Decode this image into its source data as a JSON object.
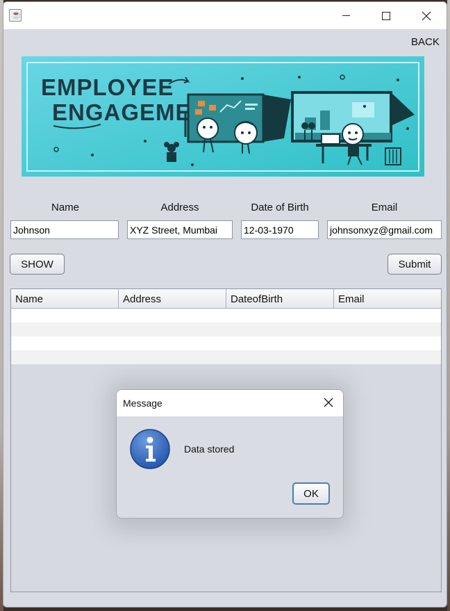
{
  "window": {
    "back_label": "BACK",
    "java_icon": "java-cup-icon"
  },
  "banner": {
    "line1": "EMPLOYEE",
    "line2": "ENGAGEMENT"
  },
  "form": {
    "labels": {
      "name": "Name",
      "address": "Address",
      "dob": "Date of Birth",
      "email": "Email"
    },
    "values": {
      "name": "Johnson",
      "address": "XYZ Street, Mumbai",
      "dob": "12-03-1970",
      "email": "johnsonxyz@gmail.com"
    }
  },
  "buttons": {
    "show": "SHOW",
    "submit": "Submit"
  },
  "table": {
    "columns": [
      "Name",
      "Address",
      "DateofBirth",
      "Email"
    ]
  },
  "dialog": {
    "title": "Message",
    "message": "Data stored",
    "ok": "OK",
    "icon": "info-icon"
  },
  "colors": {
    "window_bg": "#d8dbe2",
    "banner_bg": "#3ec8d0",
    "ok_border": "#4f7bb3",
    "info_icon": "#2a5db0"
  }
}
